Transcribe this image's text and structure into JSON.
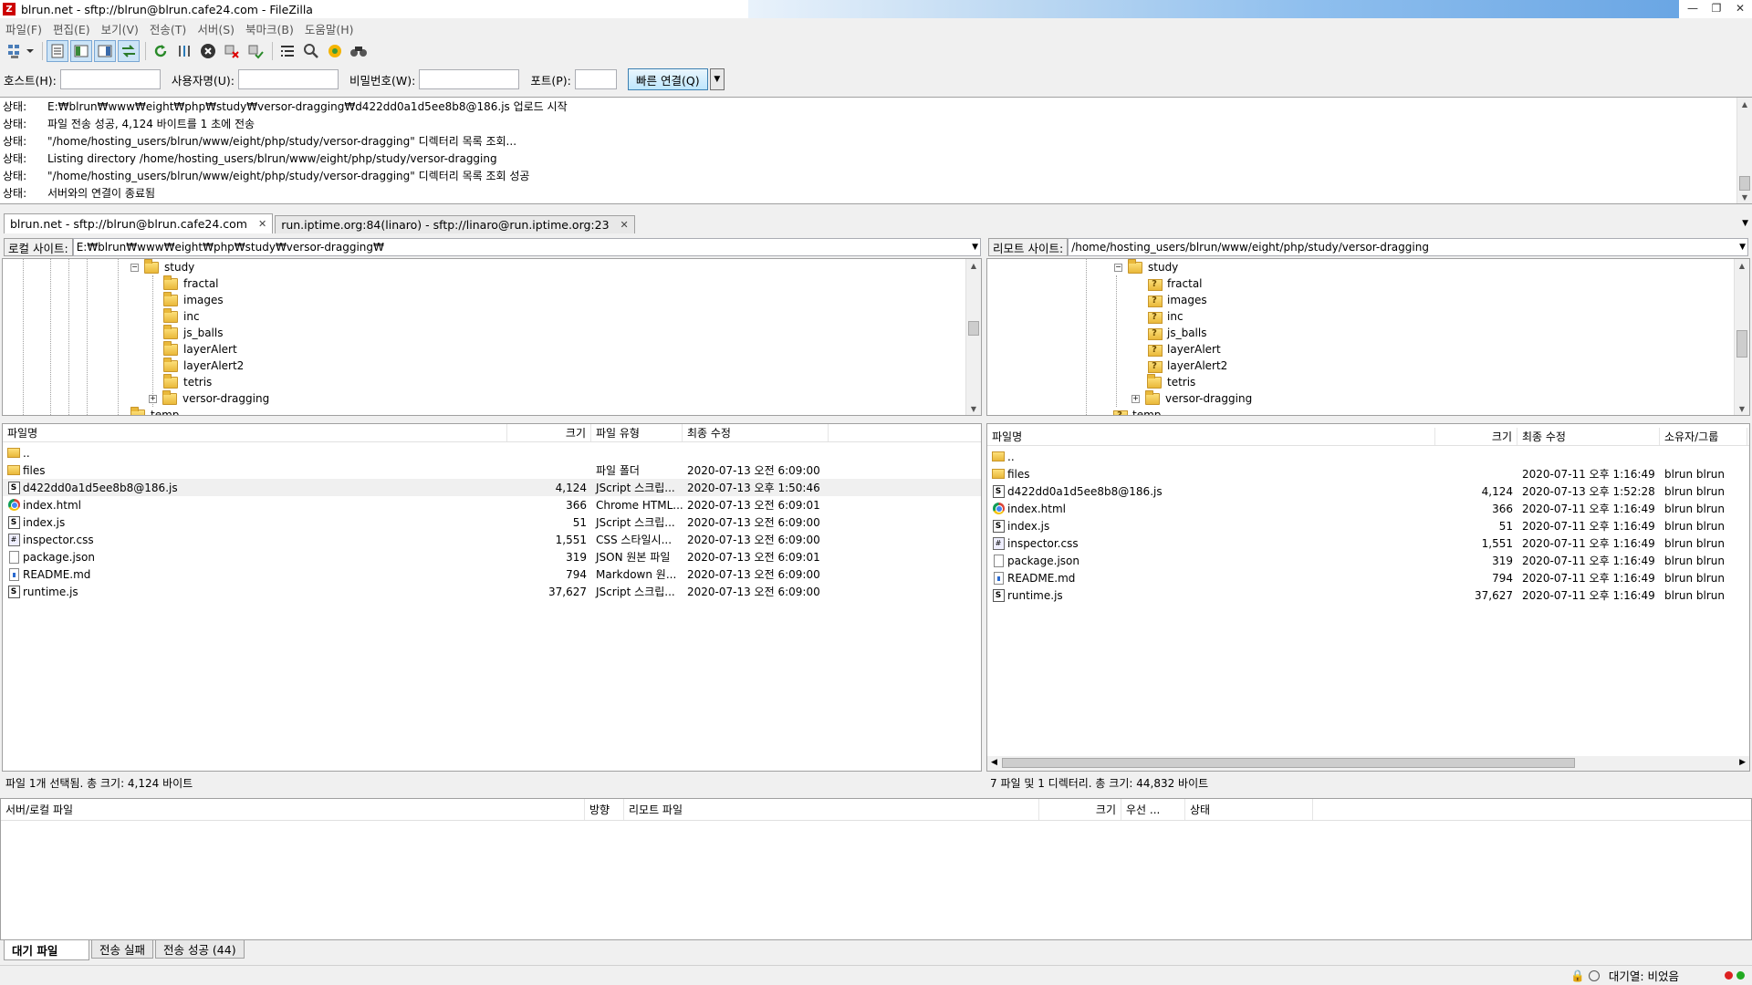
{
  "window": {
    "title": "blrun.net - sftp://blrun@blrun.cafe24.com - FileZilla",
    "app_icon": "Z"
  },
  "menu": [
    "파일(F)",
    "편집(E)",
    "보기(V)",
    "전송(T)",
    "서버(S)",
    "북마크(B)",
    "도움말(H)"
  ],
  "quickconnect": {
    "host_label": "호스트(H):",
    "host_value": "",
    "user_label": "사용자명(U):",
    "user_value": "",
    "pass_label": "비밀번호(W):",
    "pass_value": "",
    "port_label": "포트(P):",
    "port_value": "",
    "connect_label": "빠른 연결(Q)"
  },
  "log": [
    {
      "k": "상태:",
      "v": "E:₩blrun₩www₩eight₩php₩study₩versor-dragging₩d422dd0a1d5ee8b8@186.js 업로드 시작"
    },
    {
      "k": "상태:",
      "v": "파일 전송 성공, 4,124 바이트를 1 초에 전송"
    },
    {
      "k": "상태:",
      "v": "\"/home/hosting_users/blrun/www/eight/php/study/versor-dragging\" 디렉터리 목록 조회..."
    },
    {
      "k": "상태:",
      "v": "Listing directory /home/hosting_users/blrun/www/eight/php/study/versor-dragging"
    },
    {
      "k": "상태:",
      "v": "\"/home/hosting_users/blrun/www/eight/php/study/versor-dragging\" 디렉터리 목록 조회 성공"
    },
    {
      "k": "상태:",
      "v": "서버와의 연결이 종료됨"
    }
  ],
  "tabs": [
    {
      "label": "blrun.net - sftp://blrun@blrun.cafe24.com"
    },
    {
      "label": "run.iptime.org:84(linaro) - sftp://linaro@run.iptime.org:23"
    }
  ],
  "local": {
    "site_label": "로컬 사이트:",
    "path": "E:₩blrun₩www₩eight₩php₩study₩versor-dragging₩",
    "tree": [
      {
        "name": "study",
        "expander": "−"
      },
      {
        "name": "fractal"
      },
      {
        "name": "images"
      },
      {
        "name": "inc"
      },
      {
        "name": "js_balls"
      },
      {
        "name": "layerAlert"
      },
      {
        "name": "layerAlert2"
      },
      {
        "name": "tetris"
      },
      {
        "name": "versor-dragging",
        "expander": "+"
      },
      {
        "name": "temp"
      }
    ],
    "headers": [
      "파일명",
      "크기",
      "파일 유형",
      "최종 수정"
    ],
    "files": [
      {
        "name": "..",
        "size": "",
        "type": "",
        "modified": "",
        "icon": "folder"
      },
      {
        "name": "files",
        "size": "",
        "type": "파일 폴더",
        "modified": "2020-07-13 오전 6:09:00",
        "icon": "folder"
      },
      {
        "name": "d422dd0a1d5ee8b8@186.js",
        "size": "4,124",
        "type": "JScript 스크립...",
        "modified": "2020-07-13 오후 1:50:46",
        "icon": "js"
      },
      {
        "name": "index.html",
        "size": "366",
        "type": "Chrome HTML...",
        "modified": "2020-07-13 오전 6:09:01",
        "icon": "chrome"
      },
      {
        "name": "index.js",
        "size": "51",
        "type": "JScript 스크립...",
        "modified": "2020-07-13 오전 6:09:00",
        "icon": "js"
      },
      {
        "name": "inspector.css",
        "size": "1,551",
        "type": "CSS 스타일시...",
        "modified": "2020-07-13 오전 6:09:00",
        "icon": "css"
      },
      {
        "name": "package.json",
        "size": "319",
        "type": "JSON 원본 파일",
        "modified": "2020-07-13 오전 6:09:01",
        "icon": "doc"
      },
      {
        "name": "README.md",
        "size": "794",
        "type": "Markdown 원...",
        "modified": "2020-07-13 오전 6:09:00",
        "icon": "md"
      },
      {
        "name": "runtime.js",
        "size": "37,627",
        "type": "JScript 스크립...",
        "modified": "2020-07-13 오전 6:09:00",
        "icon": "js"
      }
    ],
    "status": "파일 1개 선택됨. 총 크기: 4,124 바이트"
  },
  "remote": {
    "site_label": "리모트 사이트:",
    "path": "/home/hosting_users/blrun/www/eight/php/study/versor-dragging",
    "tree": [
      {
        "name": "study",
        "expander": "−",
        "icon": "folder"
      },
      {
        "name": "fractal",
        "icon": "q"
      },
      {
        "name": "images",
        "icon": "q"
      },
      {
        "name": "inc",
        "icon": "q"
      },
      {
        "name": "js_balls",
        "icon": "q"
      },
      {
        "name": "layerAlert",
        "icon": "q"
      },
      {
        "name": "layerAlert2",
        "icon": "q"
      },
      {
        "name": "tetris",
        "icon": "folder"
      },
      {
        "name": "versor-dragging",
        "expander": "+",
        "icon": "folder"
      },
      {
        "name": "temp",
        "icon": "q"
      }
    ],
    "headers": [
      "파일명",
      "크기",
      "최종 수정",
      "소유자/그룹"
    ],
    "files": [
      {
        "name": "..",
        "size": "",
        "modified": "",
        "owner": "",
        "icon": "folder"
      },
      {
        "name": "files",
        "size": "",
        "modified": "2020-07-11 오후 1:16:49",
        "owner": "blrun blrun",
        "icon": "folder"
      },
      {
        "name": "d422dd0a1d5ee8b8@186.js",
        "size": "4,124",
        "modified": "2020-07-13 오후 1:52:28",
        "owner": "blrun blrun",
        "icon": "js"
      },
      {
        "name": "index.html",
        "size": "366",
        "modified": "2020-07-11 오후 1:16:49",
        "owner": "blrun blrun",
        "icon": "chrome"
      },
      {
        "name": "index.js",
        "size": "51",
        "modified": "2020-07-11 오후 1:16:49",
        "owner": "blrun blrun",
        "icon": "js"
      },
      {
        "name": "inspector.css",
        "size": "1,551",
        "modified": "2020-07-11 오후 1:16:49",
        "owner": "blrun blrun",
        "icon": "css"
      },
      {
        "name": "package.json",
        "size": "319",
        "modified": "2020-07-11 오후 1:16:49",
        "owner": "blrun blrun",
        "icon": "doc"
      },
      {
        "name": "README.md",
        "size": "794",
        "modified": "2020-07-11 오후 1:16:49",
        "owner": "blrun blrun",
        "icon": "md"
      },
      {
        "name": "runtime.js",
        "size": "37,627",
        "modified": "2020-07-11 오후 1:16:49",
        "owner": "blrun blrun",
        "icon": "js"
      }
    ],
    "status": "7 파일 및 1 디렉터리. 총 크기: 44,832 바이트"
  },
  "queue": {
    "headers": [
      "서버/로컬 파일",
      "방향",
      "리모트 파일",
      "크기",
      "우선 ...",
      "상태"
    ],
    "tabs": [
      "대기 파일",
      "전송 실패",
      "전송 성공 (44)"
    ]
  },
  "statusbar": {
    "queue_text": "대기열: 비었음"
  },
  "icons": {
    "toolbar": [
      "site-manager-icon",
      "toggle-log-icon",
      "toggle-local-tree-icon",
      "toggle-remote-tree-icon",
      "toggle-queue-icon",
      "refresh-icon",
      "process-queue-icon",
      "cancel-icon",
      "disconnect-icon",
      "reconnect-icon",
      "filter-icon",
      "compare-icon",
      "sync-browse-icon",
      "search-icon"
    ]
  },
  "colors": {
    "accent": "#3c7fb1",
    "selection": "#cce4f7",
    "folder": "#e9b83a"
  }
}
